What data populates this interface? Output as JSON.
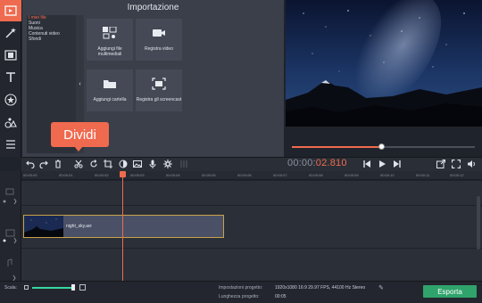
{
  "import_panel": {
    "title": "Importazione",
    "categories": [
      "I miei file",
      "Suoni",
      "Musica",
      "Contenuti video",
      "Sfondi"
    ],
    "tiles": [
      {
        "label": "Aggiungi file multimediali",
        "icon": "media-files-icon"
      },
      {
        "label": "Registra video",
        "icon": "video-camera-icon"
      },
      {
        "label": "Aggiungi cartella",
        "icon": "folder-icon"
      },
      {
        "label": "Registra gli screencast",
        "icon": "screencast-icon"
      }
    ]
  },
  "rail_icons": [
    "import-icon",
    "magic-wand-icon",
    "filmstrip-icon",
    "text-icon",
    "star-icon",
    "shapes-icon",
    "list-icon"
  ],
  "tooltip": {
    "label": "Dividi"
  },
  "timecode": {
    "grey": "00:00:",
    "highlight": "02.810"
  },
  "player": {
    "progress": 0.49
  },
  "ruler_ticks": [
    "00:00:00",
    "00:00:01",
    "00:00:02",
    "00:00:03",
    "00:00:04",
    "00:00:05",
    "00:00:06",
    "00:00:07",
    "00:00:08",
    "00:00:09",
    "00:00:10",
    "00:00:11",
    "00:00:12"
  ],
  "clip": {
    "name": "night_sky.avi"
  },
  "status": {
    "scale_label": "Scala:",
    "settings_label": "Impostazioni progetto:",
    "settings_value": "1920x1080 16:9 29.97 FPS, 44100 Hz Stereo",
    "length_label": "Lunghezza progetto:",
    "length_value": "00:05",
    "export_label": "Esporta"
  },
  "colors": {
    "accent": "#ef6b4f",
    "export": "#2fa36b",
    "scale": "#36d6a0"
  }
}
